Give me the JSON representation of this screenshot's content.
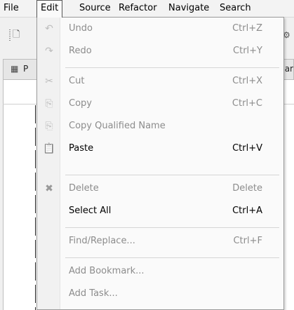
{
  "menubar": {
    "items": [
      "File",
      "Edit",
      "Source",
      "Refactor",
      "Navigate",
      "Search"
    ],
    "active": "Edit"
  },
  "view": {
    "tab_letter": "P",
    "tab_right_fragment": "ar"
  },
  "edit_menu": {
    "items": [
      {
        "label": "Undo",
        "shortcut": "Ctrl+Z",
        "icon": "undo-icon",
        "enabled": false
      },
      {
        "label": "Redo",
        "shortcut": "Ctrl+Y",
        "icon": "redo-icon",
        "enabled": false
      },
      {
        "label": "Cut",
        "shortcut": "Ctrl+X",
        "icon": "cut-icon",
        "enabled": false
      },
      {
        "label": "Copy",
        "shortcut": "Ctrl+C",
        "icon": "copy-icon",
        "enabled": false
      },
      {
        "label": "Copy Qualified Name",
        "shortcut": "",
        "icon": "copy-qualified-name-icon",
        "enabled": false
      },
      {
        "label": "Paste",
        "shortcut": "Ctrl+V",
        "icon": "paste-icon",
        "enabled": true
      },
      {
        "label": "Delete",
        "shortcut": "Delete",
        "icon": "delete-icon",
        "enabled": false
      },
      {
        "label": "Select All",
        "shortcut": "Ctrl+A",
        "icon": "",
        "enabled": true
      },
      {
        "label": "Find/Replace...",
        "shortcut": "Ctrl+F",
        "icon": "",
        "enabled": false
      },
      {
        "label": "Add Bookmark...",
        "shortcut": "",
        "icon": "",
        "enabled": false
      },
      {
        "label": "Add Task...",
        "shortcut": "",
        "icon": "",
        "enabled": false
      }
    ]
  }
}
